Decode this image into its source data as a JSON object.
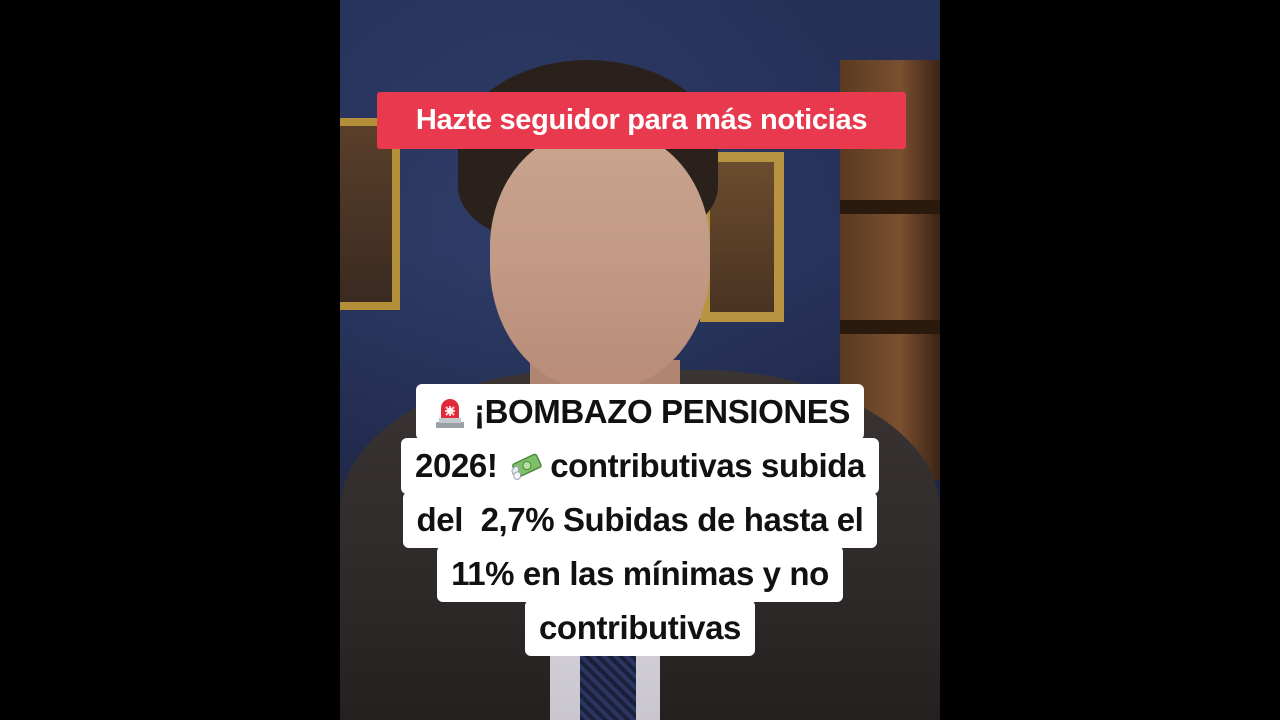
{
  "banner": {
    "text": "Hazte seguidor para más noticias",
    "color": "#e8394e"
  },
  "caption": {
    "line1": "¡BOMBAZO PENSIONES",
    "line2a": "2026! ",
    "line2b": "contributivas subida",
    "line3": "del  2,7% Subidas de hasta el",
    "line4": "11% en las mínimas y no",
    "line5": "contributivas",
    "icons": [
      "police-light-icon",
      "money-with-wings-icon"
    ]
  }
}
